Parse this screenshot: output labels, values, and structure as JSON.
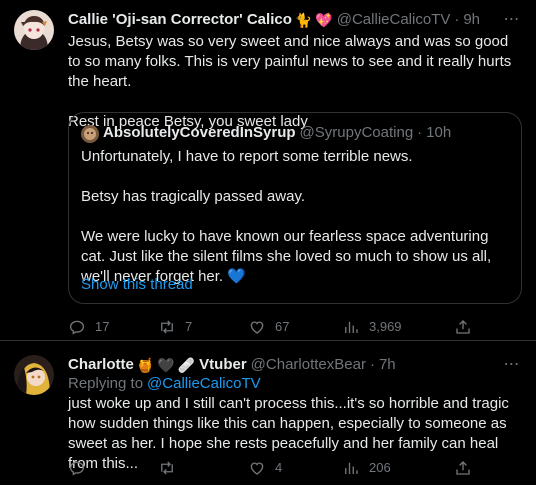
{
  "tweet1": {
    "display_name": "Callie 'Oji-san Corrector' Calico",
    "badges": [
      "🐈",
      "💖"
    ],
    "handle": "@CallieCalicoTV",
    "sep": "·",
    "time": "9h",
    "text": "Jesus, Betsy was so very sweet and nice always and was so good to so many folks. This is very painful news to see and it really hurts the heart.\n\nRest in peace Betsy, you sweet lady",
    "quote": {
      "display_name": "AbsolutelyCoveredInSyrup",
      "handle": "@SyrupyCoating",
      "sep": "·",
      "time": "10h",
      "text": "Unfortunately, I have to report some terrible news.\n\nBetsy has tragically passed away.\n\nWe were lucky to have known our fearless space adventuring cat. Just like the silent films she loved so much to show us all, we'll never forget her. 💙",
      "show_thread": "Show this thread"
    },
    "stats": {
      "replies": "17",
      "retweets": "7",
      "likes": "67",
      "views": "3,969"
    }
  },
  "tweet2": {
    "display_name": "Charlotte",
    "badges": [
      "🍯",
      "🖤",
      "🩹"
    ],
    "name_suffix": "Vtuber",
    "handle": "@CharlottexBear",
    "sep": "·",
    "time": "7h",
    "replying_label": "Replying to",
    "replying_handle": "@CallieCalicoTV",
    "text": "just woke up and I still can't process this...it's so horrible and tragic how sudden things like this can happen, especially to someone as sweet as her. I hope she rests peacefully and her family can heal from this...",
    "stats": {
      "replies": "",
      "retweets": "",
      "likes": "4",
      "views": "206"
    }
  },
  "more_icon": "⋯",
  "colors": {
    "background": "#000000",
    "text": "#e7e9ea",
    "muted": "#71767b",
    "link": "#1d9bf0",
    "border": "#2f3336",
    "heart": "#5aa9e6"
  }
}
